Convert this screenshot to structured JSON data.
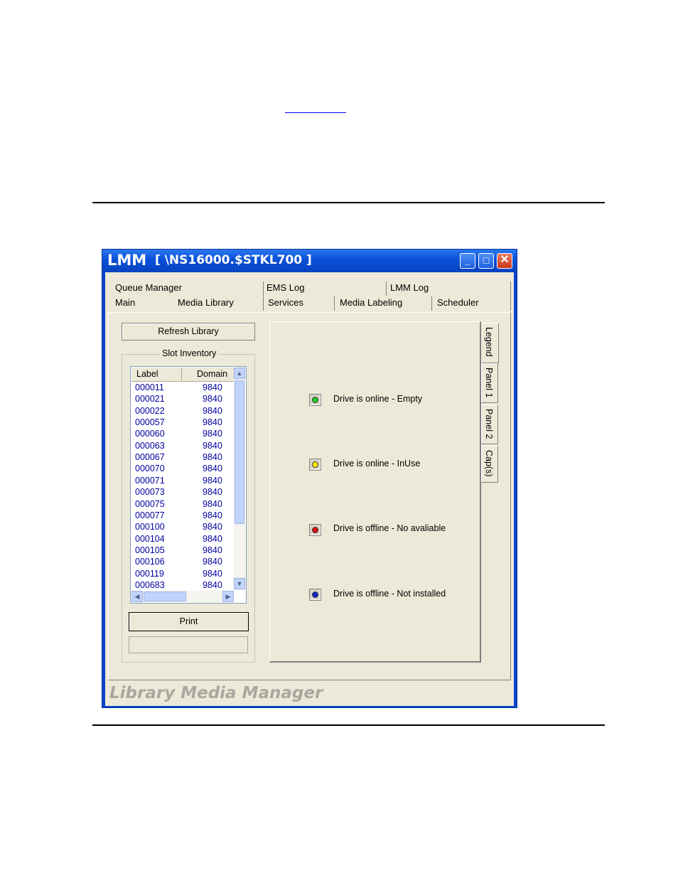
{
  "window": {
    "app_title": "LMM",
    "system_title": "[ \\NS16000.$STKL700 ]",
    "minimize_glyph": "_",
    "maximize_glyph": "□",
    "close_glyph": "✕"
  },
  "tabs": {
    "row1": [
      "Queue Manager",
      "EMS Log",
      "LMM Log"
    ],
    "row2": [
      "Main",
      "Media Library",
      "Services",
      "Media Labeling",
      "Scheduler"
    ],
    "active": "Media Library"
  },
  "left": {
    "refresh_label": "Refresh Library",
    "group_title": "Slot Inventory",
    "columns": [
      "Label",
      "Domain"
    ],
    "rows": [
      [
        "000011",
        "9840"
      ],
      [
        "000021",
        "9840"
      ],
      [
        "000022",
        "9840"
      ],
      [
        "000057",
        "9840"
      ],
      [
        "000060",
        "9840"
      ],
      [
        "000063",
        "9840"
      ],
      [
        "000067",
        "9840"
      ],
      [
        "000070",
        "9840"
      ],
      [
        "000071",
        "9840"
      ],
      [
        "000073",
        "9840"
      ],
      [
        "000075",
        "9840"
      ],
      [
        "000077",
        "9840"
      ],
      [
        "000100",
        "9840"
      ],
      [
        "000104",
        "9840"
      ],
      [
        "000105",
        "9840"
      ],
      [
        "000106",
        "9840"
      ],
      [
        "000119",
        "9840"
      ],
      [
        "000683",
        "9840"
      ]
    ],
    "print_label": "Print"
  },
  "side_tabs": [
    "Legend",
    "Panel 1",
    "Panel 2",
    "Cap(s)"
  ],
  "legend": [
    {
      "text": "Drive is online - Empty",
      "color": "#22cc22"
    },
    {
      "text": "Drive is online - InUse",
      "color": "#ffee00"
    },
    {
      "text": "Drive is offline - No avaliable",
      "color": "#dd1111"
    },
    {
      "text": "Drive is offline - Not installed",
      "color": "#1122cc"
    }
  ],
  "footer": "Library Media Manager"
}
